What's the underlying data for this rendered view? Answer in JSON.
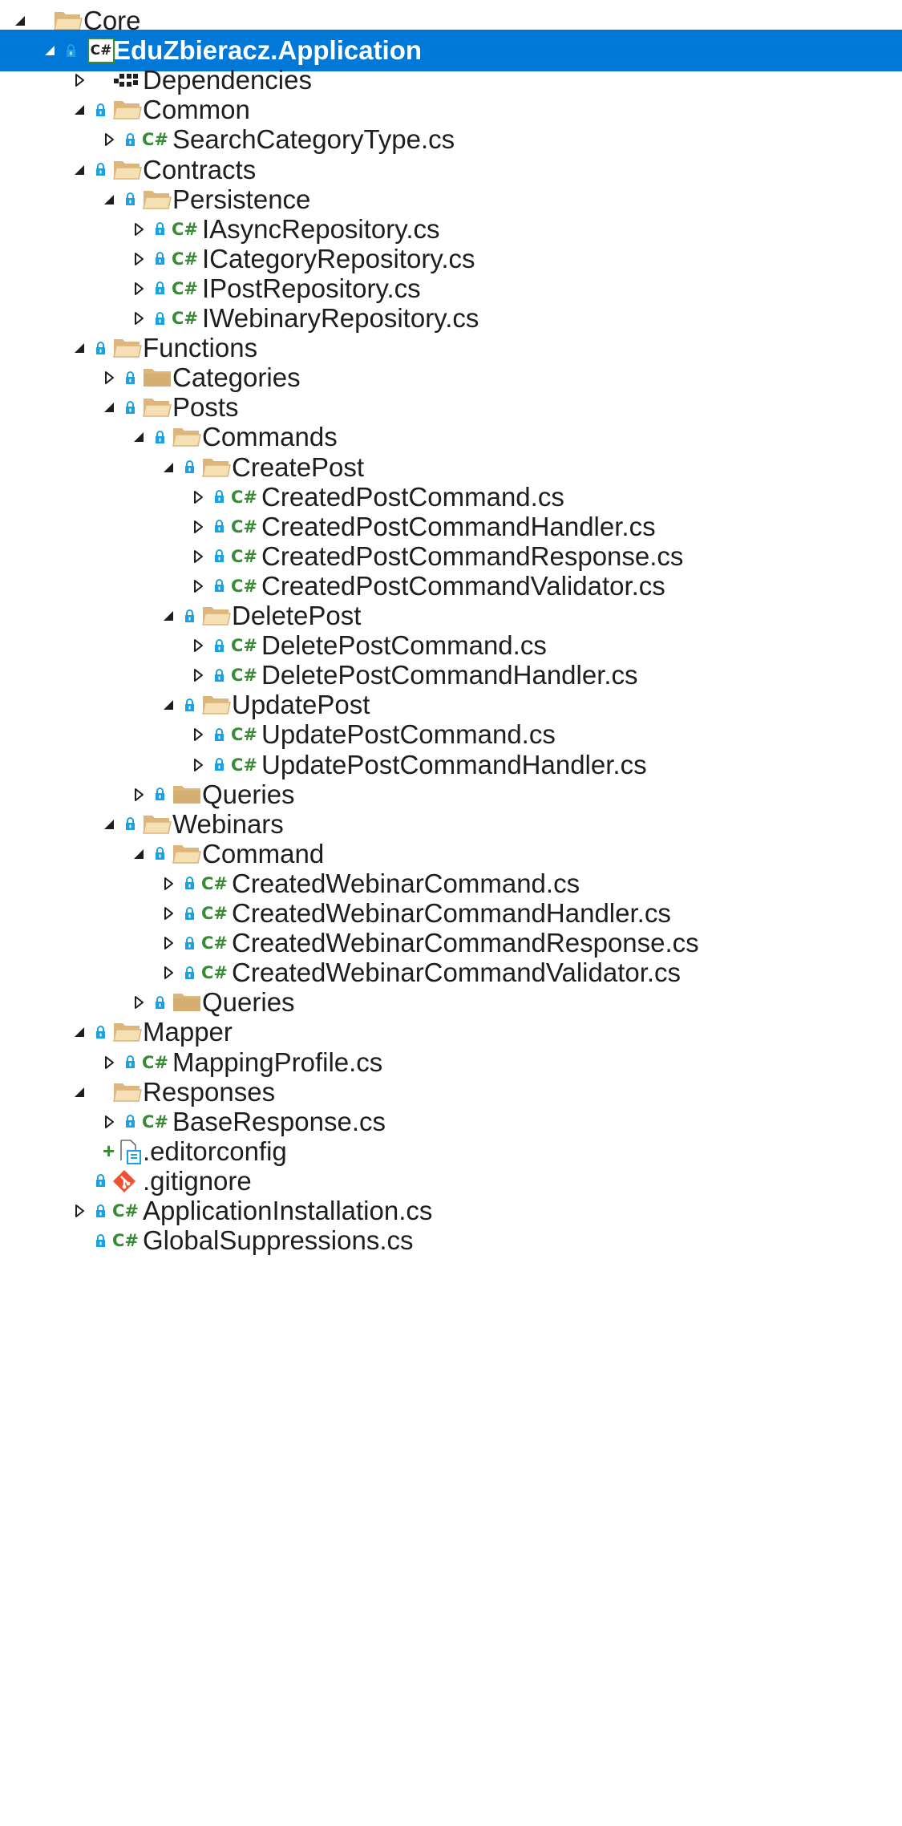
{
  "tree": [
    {
      "depth": 0,
      "label": "Core",
      "expander": "expanded",
      "icon": "folder-open",
      "locked": false
    },
    {
      "depth": 1,
      "label": "EduZbieracz.Application",
      "expander": "expanded",
      "icon": "csharp-project",
      "locked": true,
      "selected": true
    },
    {
      "depth": 2,
      "label": "Dependencies",
      "expander": "collapsed",
      "icon": "dependencies",
      "locked": false
    },
    {
      "depth": 2,
      "label": "Common",
      "expander": "expanded",
      "icon": "folder-open",
      "locked": true
    },
    {
      "depth": 3,
      "label": "SearchCategoryType.cs",
      "expander": "collapsed",
      "icon": "csharp-file",
      "locked": true
    },
    {
      "depth": 2,
      "label": "Contracts",
      "expander": "expanded",
      "icon": "folder-open",
      "locked": true
    },
    {
      "depth": 3,
      "label": "Persistence",
      "expander": "expanded",
      "icon": "folder-open",
      "locked": true
    },
    {
      "depth": 4,
      "label": "IAsyncRepository.cs",
      "expander": "collapsed",
      "icon": "csharp-file",
      "locked": true
    },
    {
      "depth": 4,
      "label": "ICategoryRepository.cs",
      "expander": "collapsed",
      "icon": "csharp-file",
      "locked": true
    },
    {
      "depth": 4,
      "label": "IPostRepository.cs",
      "expander": "collapsed",
      "icon": "csharp-file",
      "locked": true
    },
    {
      "depth": 4,
      "label": "IWebinaryRepository.cs",
      "expander": "collapsed",
      "icon": "csharp-file",
      "locked": true
    },
    {
      "depth": 2,
      "label": "Functions",
      "expander": "expanded",
      "icon": "folder-open",
      "locked": true
    },
    {
      "depth": 3,
      "label": "Categories",
      "expander": "collapsed",
      "icon": "folder-closed",
      "locked": true
    },
    {
      "depth": 3,
      "label": "Posts",
      "expander": "expanded",
      "icon": "folder-open",
      "locked": true
    },
    {
      "depth": 4,
      "label": "Commands",
      "expander": "expanded",
      "icon": "folder-open",
      "locked": true
    },
    {
      "depth": 5,
      "label": "CreatePost",
      "expander": "expanded",
      "icon": "folder-open",
      "locked": true
    },
    {
      "depth": 6,
      "label": "CreatedPostCommand.cs",
      "expander": "collapsed",
      "icon": "csharp-file",
      "locked": true
    },
    {
      "depth": 6,
      "label": "CreatedPostCommandHandler.cs",
      "expander": "collapsed",
      "icon": "csharp-file",
      "locked": true
    },
    {
      "depth": 6,
      "label": "CreatedPostCommandResponse.cs",
      "expander": "collapsed",
      "icon": "csharp-file",
      "locked": true
    },
    {
      "depth": 6,
      "label": "CreatedPostCommandValidator.cs",
      "expander": "collapsed",
      "icon": "csharp-file",
      "locked": true
    },
    {
      "depth": 5,
      "label": "DeletePost",
      "expander": "expanded",
      "icon": "folder-open",
      "locked": true
    },
    {
      "depth": 6,
      "label": "DeletePostCommand.cs",
      "expander": "collapsed",
      "icon": "csharp-file",
      "locked": true
    },
    {
      "depth": 6,
      "label": "DeletePostCommandHandler.cs",
      "expander": "collapsed",
      "icon": "csharp-file",
      "locked": true
    },
    {
      "depth": 5,
      "label": "UpdatePost",
      "expander": "expanded",
      "icon": "folder-open",
      "locked": true
    },
    {
      "depth": 6,
      "label": "UpdatePostCommand.cs",
      "expander": "collapsed",
      "icon": "csharp-file",
      "locked": true
    },
    {
      "depth": 6,
      "label": "UpdatePostCommandHandler.cs",
      "expander": "collapsed",
      "icon": "csharp-file",
      "locked": true
    },
    {
      "depth": 4,
      "label": "Queries",
      "expander": "collapsed",
      "icon": "folder-closed",
      "locked": true
    },
    {
      "depth": 3,
      "label": "Webinars",
      "expander": "expanded",
      "icon": "folder-open",
      "locked": true
    },
    {
      "depth": 4,
      "label": "Command",
      "expander": "expanded",
      "icon": "folder-open",
      "locked": true
    },
    {
      "depth": 5,
      "label": "CreatedWebinarCommand.cs",
      "expander": "collapsed",
      "icon": "csharp-file",
      "locked": true
    },
    {
      "depth": 5,
      "label": "CreatedWebinarCommandHandler.cs",
      "expander": "collapsed",
      "icon": "csharp-file",
      "locked": true
    },
    {
      "depth": 5,
      "label": "CreatedWebinarCommandResponse.cs",
      "expander": "collapsed",
      "icon": "csharp-file",
      "locked": true
    },
    {
      "depth": 5,
      "label": "CreatedWebinarCommandValidator.cs",
      "expander": "collapsed",
      "icon": "csharp-file",
      "locked": true
    },
    {
      "depth": 4,
      "label": "Queries",
      "expander": "collapsed",
      "icon": "folder-closed",
      "locked": true
    },
    {
      "depth": 2,
      "label": "Mapper",
      "expander": "expanded",
      "icon": "folder-open",
      "locked": true
    },
    {
      "depth": 3,
      "label": "MappingProfile.cs",
      "expander": "collapsed",
      "icon": "csharp-file",
      "locked": true
    },
    {
      "depth": 2,
      "label": "Responses",
      "expander": "expanded",
      "icon": "folder-open",
      "locked": false
    },
    {
      "depth": 3,
      "label": "BaseResponse.cs",
      "expander": "collapsed",
      "icon": "csharp-file",
      "locked": true
    },
    {
      "depth": 2,
      "label": ".editorconfig",
      "expander": "none",
      "icon": "editorconfig-file",
      "locked": false,
      "added": true
    },
    {
      "depth": 2,
      "label": ".gitignore",
      "expander": "none",
      "icon": "git-file",
      "locked": true
    },
    {
      "depth": 2,
      "label": "ApplicationInstallation.cs",
      "expander": "collapsed",
      "icon": "csharp-file",
      "locked": true
    },
    {
      "depth": 2,
      "label": "GlobalSuppressions.cs",
      "expander": "none",
      "icon": "csharp-file",
      "locked": true
    }
  ],
  "colors": {
    "selection": "#0078d7",
    "folder": "#dcb67a",
    "csharp": "#388a34",
    "lock": "#1ba1e2",
    "git": "#f05033",
    "added": "#388a34"
  },
  "glyphs": {
    "csharp": "C#",
    "csharp_project": "C#",
    "added_marker": "+"
  }
}
